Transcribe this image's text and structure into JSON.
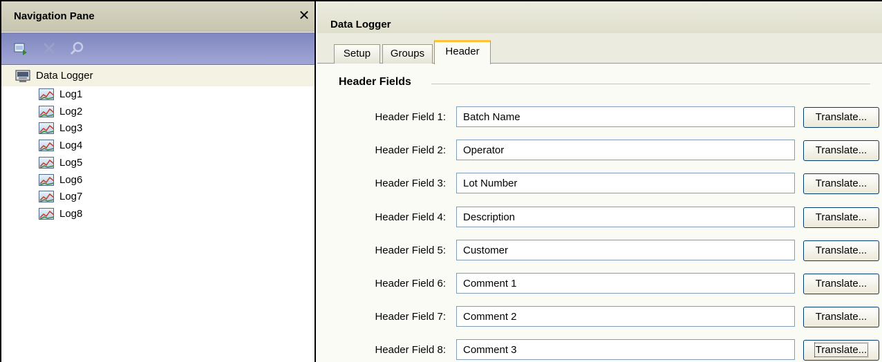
{
  "nav": {
    "title": "Navigation Pane",
    "close_glyph": "✕",
    "toolbar_icons": [
      "new-item-icon",
      "delete-icon",
      "find-icon"
    ],
    "root_label": "Data Logger",
    "logs": [
      "Log1",
      "Log2",
      "Log3",
      "Log4",
      "Log5",
      "Log6",
      "Log7",
      "Log8"
    ]
  },
  "main": {
    "title": "Data Logger",
    "tabs": [
      {
        "label": "Setup",
        "active": false
      },
      {
        "label": "Groups",
        "active": false
      },
      {
        "label": "Header",
        "active": true
      }
    ],
    "section_title": "Header Fields",
    "fields": [
      {
        "label": "Header Field 1:",
        "value": "Batch Name",
        "button": "Translate..."
      },
      {
        "label": "Header Field 2:",
        "value": "Operator",
        "button": "Translate..."
      },
      {
        "label": "Header Field 3:",
        "value": "Lot Number",
        "button": "Translate..."
      },
      {
        "label": "Header Field 4:",
        "value": "Description",
        "button": "Translate..."
      },
      {
        "label": "Header Field 5:",
        "value": "Customer",
        "button": "Translate..."
      },
      {
        "label": "Header Field 6:",
        "value": "Comment 1",
        "button": "Translate..."
      },
      {
        "label": "Header Field 7:",
        "value": "Comment 2",
        "button": "Translate..."
      },
      {
        "label": "Header Field 8:",
        "value": "Comment 3",
        "button": "Translate..."
      }
    ]
  },
  "colors": {
    "accent_tab": "#ffc33a",
    "toolbar": "#8f95c9",
    "title_bar": "#cfcdb9"
  }
}
